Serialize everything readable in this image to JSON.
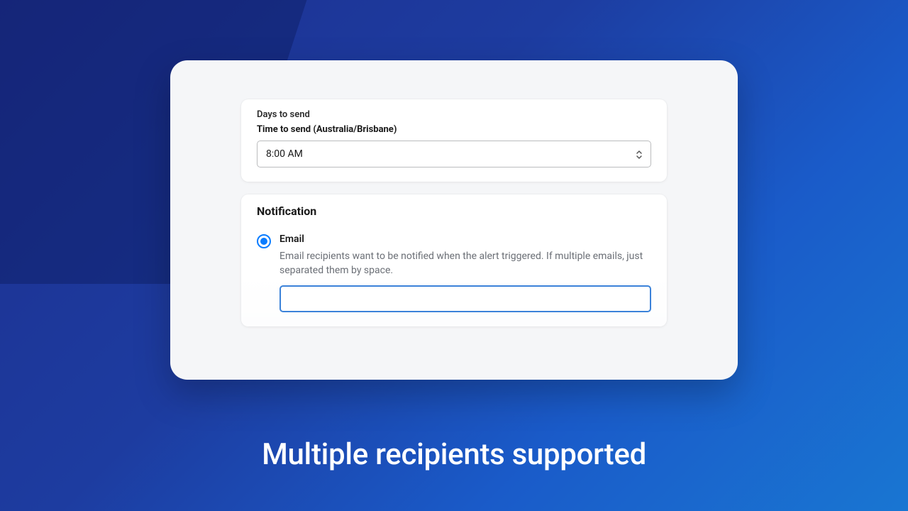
{
  "schedule_card": {
    "days_label": "Days to send",
    "time_label": "Time to send (Australia/Brisbane)",
    "time_value": "8:00 AM"
  },
  "notification_card": {
    "title": "Notification",
    "email_option": {
      "label": "Email",
      "description": "Email recipients want to be notified when the alert triggered. If multiple emails, just separated them by space.",
      "value": ""
    }
  },
  "caption": "Multiple recipients supported"
}
